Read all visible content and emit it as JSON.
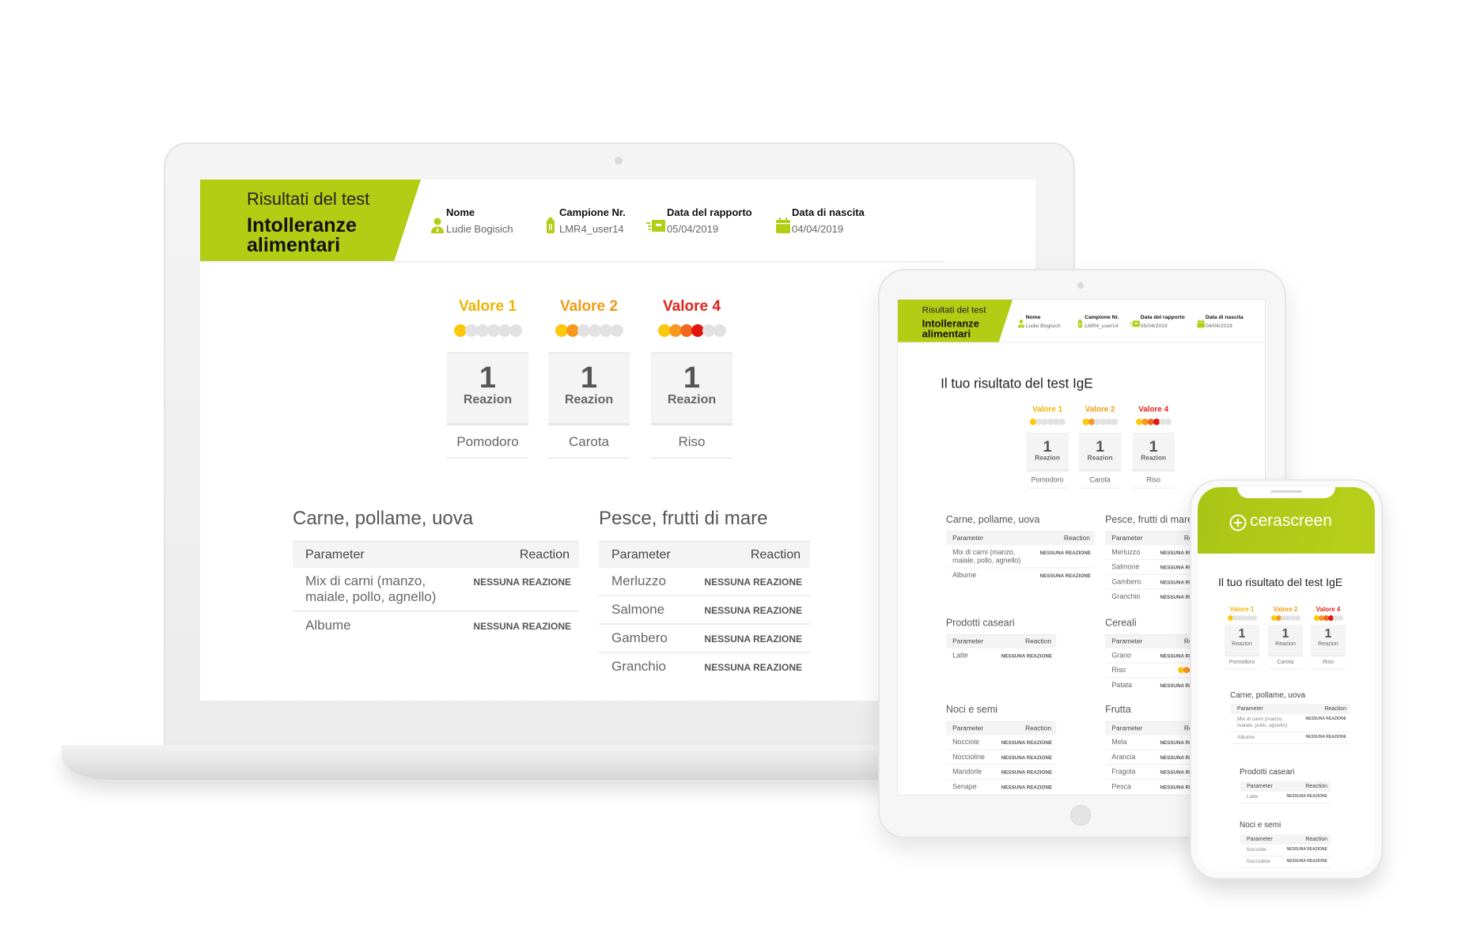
{
  "header": {
    "kicker": "Risultati del test",
    "title_line1": "Intolleranze",
    "title_line2": "alimentari"
  },
  "info": [
    {
      "label": "Nome",
      "value": "Ludie Bogisich",
      "icon": "user-icon"
    },
    {
      "label": "Campione Nr.",
      "value": "LMR4_user14",
      "icon": "sample-tube-icon"
    },
    {
      "label": "Data del rapporto",
      "value": "05/04/2019",
      "icon": "delivery-box-icon"
    },
    {
      "label": "Data di nascita",
      "value": "04/04/2019",
      "icon": "calendar-icon"
    }
  ],
  "result_heading": "Il tuo risultato del test IgE",
  "results": [
    {
      "level_label": "Valore 1",
      "level": 1,
      "max_level": 6,
      "count": "1",
      "unit": "Reazion",
      "food": "Pomodoro",
      "color": "#f0b400"
    },
    {
      "level_label": "Valore 2",
      "level": 2,
      "max_level": 6,
      "count": "1",
      "unit": "Reazion",
      "food": "Carota",
      "color": "#f29a12"
    },
    {
      "level_label": "Valore 4",
      "level": 4,
      "max_level": 6,
      "count": "1",
      "unit": "Reazion",
      "food": "Riso",
      "color": "#e2231a"
    }
  ],
  "table_headers": {
    "parameter": "Parameter",
    "reaction": "Reaction"
  },
  "categories": [
    {
      "title": "Carne, pollame, uova",
      "rows": [
        {
          "parameter": "Mix di carni (manzo, maiale, pollo, agnello)",
          "reaction": "NESSUNA REAZIONE"
        },
        {
          "parameter": "Albume",
          "reaction": "NESSUNA REAZIONE"
        }
      ]
    },
    {
      "title": "Pesce, frutti di mare",
      "rows": [
        {
          "parameter": "Merluzzo",
          "reaction": "NESSUNA REAZIONE"
        },
        {
          "parameter": "Salmone",
          "reaction": "NESSUNA REAZIONE"
        },
        {
          "parameter": "Gambero",
          "reaction": "NESSUNA REAZIONE"
        },
        {
          "parameter": "Granchio",
          "reaction": "NESSUNA REAZIONE"
        }
      ]
    },
    {
      "title": "Prodotti caseari",
      "rows": [
        {
          "parameter": "Latte",
          "reaction": "NESSUNA REAZIONE"
        }
      ]
    },
    {
      "title": "Cereali",
      "rows": [
        {
          "parameter": "Grano",
          "reaction": "NESSUNA REAZIONE"
        },
        {
          "parameter": "Riso",
          "level": 4,
          "max_level": 6
        },
        {
          "parameter": "Patata",
          "reaction": "NESSUNA REAZIONE"
        }
      ]
    },
    {
      "title": "Noci e semi",
      "rows": [
        {
          "parameter": "Nocciole",
          "reaction": "NESSUNA REAZIONE"
        },
        {
          "parameter": "Noccioline",
          "reaction": "NESSUNA REAZIONE"
        },
        {
          "parameter": "Mandorle",
          "reaction": "NESSUNA REAZIONE"
        },
        {
          "parameter": "Senape",
          "reaction": "NESSUNA REAZIONE"
        }
      ]
    },
    {
      "title": "Frutta",
      "rows": [
        {
          "parameter": "Mela",
          "reaction": "NESSUNA REAZIONE"
        },
        {
          "parameter": "Arancia",
          "reaction": "NESSUNA REAZIONE"
        },
        {
          "parameter": "Fragola",
          "reaction": "NESSUNA REAZIONE"
        },
        {
          "parameter": "Pesca",
          "reaction": "NESSUNA REAZIONE"
        }
      ]
    }
  ],
  "brand": {
    "name": "cerascreen",
    "icon": "circle-plus-logo-icon"
  },
  "colors": {
    "accent": "#b3cc14",
    "dot_levels": [
      "#fcc80c",
      "#f7991e",
      "#f2661f",
      "#e3150f",
      "#e3150f",
      "#e3150f"
    ],
    "dot_empty": "#e2e2e2"
  }
}
